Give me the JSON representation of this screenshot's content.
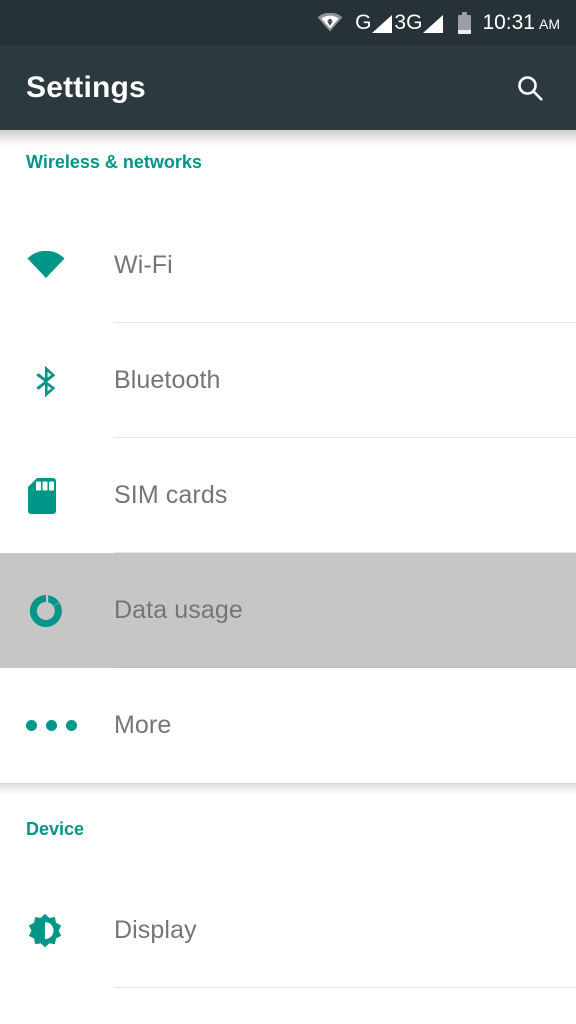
{
  "status_bar": {
    "wifi_icon": "wifi-icon",
    "signal1_label": "G",
    "signal1_icon": "signal-bars-icon",
    "signal2_label": "3G",
    "signal2_icon": "signal-bars-icon",
    "battery_icon": "battery-icon",
    "time": "10:31",
    "am_pm": "AM"
  },
  "app_bar": {
    "title": "Settings",
    "search_icon": "search-icon"
  },
  "colors": {
    "accent": "#009688",
    "app_bar_bg": "#2c393f",
    "status_bar_bg": "#263238",
    "label_text": "#757575",
    "selected_row_bg": "#c6c6c6",
    "divider": "#e4e4e4"
  },
  "sections": [
    {
      "title": "Wireless & networks",
      "items": [
        {
          "label": "Wi-Fi",
          "icon": "wifi-icon",
          "selected": false
        },
        {
          "label": "Bluetooth",
          "icon": "bluetooth-icon",
          "selected": false
        },
        {
          "label": "SIM cards",
          "icon": "sim-card-icon",
          "selected": false
        },
        {
          "label": "Data usage",
          "icon": "data-usage-icon",
          "selected": true
        },
        {
          "label": "More",
          "icon": "more-dots-icon",
          "selected": false
        }
      ]
    },
    {
      "title": "Device",
      "items": [
        {
          "label": "Display",
          "icon": "brightness-icon",
          "selected": false
        }
      ]
    }
  ]
}
